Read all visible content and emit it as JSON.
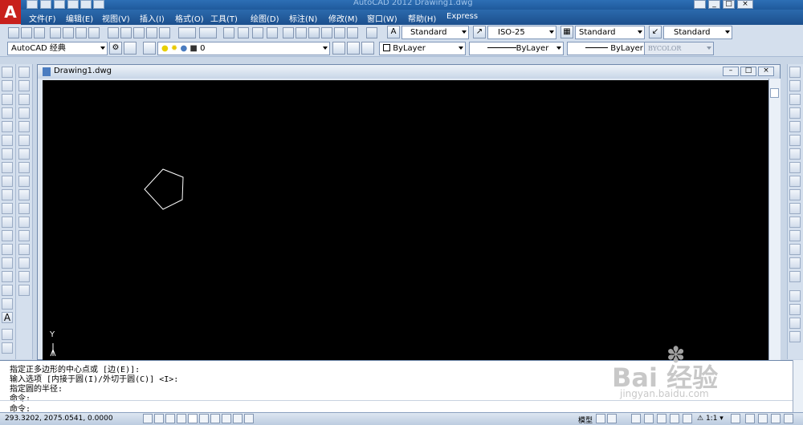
{
  "window": {
    "title": "AutoCAD 2012 Drawing1.dwg"
  },
  "app_logo": "A",
  "menu": [
    "文件(F)",
    "编辑(E)",
    "视图(V)",
    "插入(I)",
    "格式(O)",
    "工具(T)",
    "绘图(D)",
    "标注(N)",
    "修改(M)",
    "窗口(W)",
    "帮助(H)",
    "Express"
  ],
  "styles_toolbar": {
    "text_style": "Standard",
    "dim_style": "ISO-25",
    "table_style": "Standard",
    "mleader_style": "Standard"
  },
  "workspace": "AutoCAD 经典",
  "layer": "0",
  "properties": {
    "color": "ByLayer",
    "linetype": "ByLayer",
    "lineweight": "ByLayer",
    "plotstyle": "BYCOLOR"
  },
  "drawing_tab": "Drawing1.dwg",
  "ucs_label": "Y",
  "command_lines": [
    "指定正多边形的中心点或 [边(E)]:",
    "输入选项 [内接于圆(I)/外切于圆(C)] <I>:",
    "指定圆的半径:",
    "命令:",
    "命令:"
  ],
  "status": {
    "coordinates": "293.3202,  2075.0541, 0.0000",
    "model_label": "模型",
    "annotation_scale": "1:1"
  },
  "watermark": "Bai 经验",
  "watermark_url": "jingyan.baidu.com"
}
